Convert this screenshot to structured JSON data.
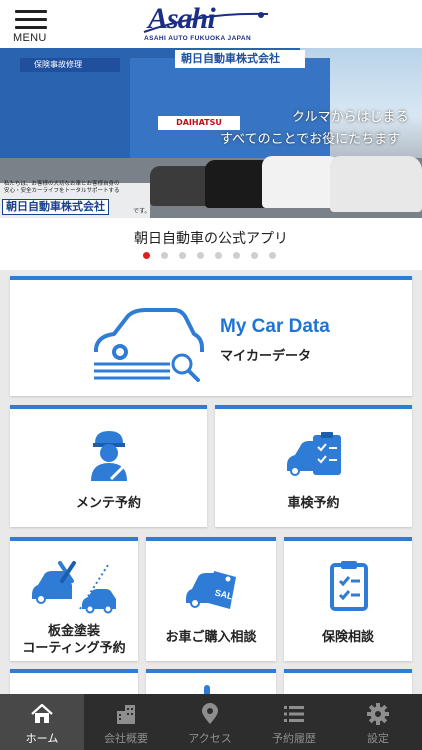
{
  "header": {
    "menu_label": "MENU",
    "logo_text": "Asahi",
    "logo_subtitle": "ASAHI AUTO FUKUOKA JAPAN"
  },
  "banner": {
    "sign_building": "朝日自動車株式会社",
    "sign_insurance": "保険事故修理",
    "sign_brand": "DAIHATSU",
    "tagline_line1": "クルマからはじまる",
    "tagline_line2": "すべてのことでお役にたちます",
    "note_line1": "私たちは、お客様の大切なお車とお客様自身の",
    "note_line2": "安心・安全カーライフをトータルサポートする",
    "company_name": "朝日自動車株式会社",
    "company_suffix": "です。"
  },
  "caption": {
    "text": "朝日自動車の公式アプリ",
    "dots_total": 8,
    "active_index": 0
  },
  "colors": {
    "accent": "#2e7cd6",
    "brand_navy": "#1b2e86",
    "active_dot": "#e02020",
    "nav_bg": "#2d2d2d"
  },
  "cards": {
    "my_car_data": {
      "title": "My Car Data",
      "subtitle": "マイカーデータ",
      "icon": "car-search-icon"
    },
    "maintenance": {
      "label": "メンテ予約",
      "icon": "mechanic-icon"
    },
    "inspection": {
      "label": "車検予約",
      "icon": "car-checklist-icon"
    },
    "bodywork": {
      "label_line1": "板金塗装",
      "label_line2": "コーティング予約",
      "icon": "car-repair-icon"
    },
    "purchase": {
      "label": "お車ご購入相談",
      "icon": "car-sale-tag-icon"
    },
    "insurance": {
      "label": "保険相談",
      "icon": "clipboard-check-icon"
    }
  },
  "bottom_nav": [
    {
      "label": "ホーム",
      "icon": "home-icon",
      "active": true
    },
    {
      "label": "会社概要",
      "icon": "building-icon",
      "active": false
    },
    {
      "label": "アクセス",
      "icon": "map-pin-icon",
      "active": false
    },
    {
      "label": "予約履歴",
      "icon": "list-icon",
      "active": false
    },
    {
      "label": "設定",
      "icon": "gear-icon",
      "active": false
    }
  ]
}
